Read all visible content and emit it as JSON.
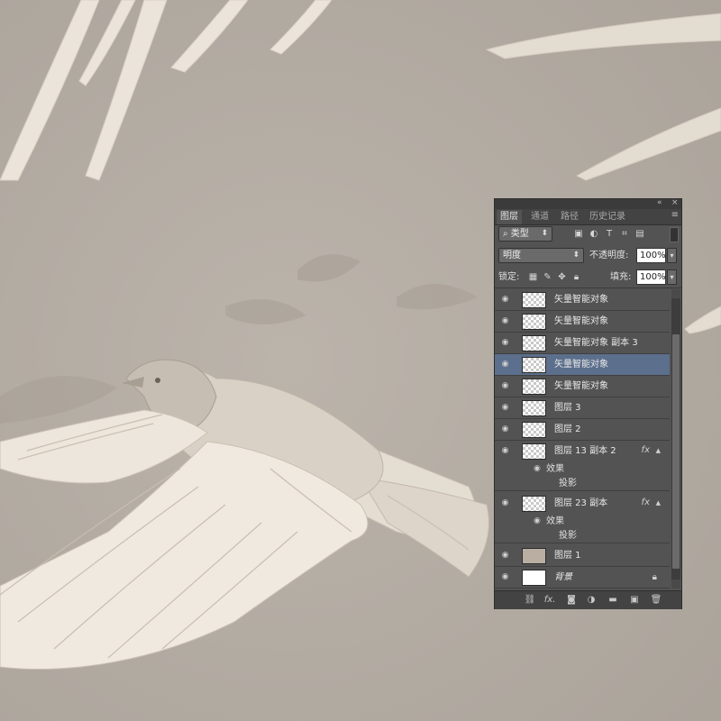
{
  "panel": {
    "collapse_icon": "double-left-arrow-icon",
    "close_icon": "close-icon",
    "tabs": [
      "图层",
      "通道",
      "路径",
      "历史记录"
    ],
    "tab_menu_icon": "panel-menu-icon",
    "filter": {
      "search_icon": "search-icon",
      "label": "类型",
      "icons": [
        "image-filter-icon",
        "adjustment-filter-icon",
        "text-filter-icon",
        "shape-filter-icon",
        "smart-object-filter-icon"
      ]
    },
    "blend_mode": "明度",
    "opacity_label": "不透明度:",
    "opacity_value": "100%",
    "lock_label": "锁定:",
    "lock_icons": [
      "lock-transparent-icon",
      "lock-image-icon",
      "lock-position-icon",
      "lock-all-icon"
    ],
    "fill_label": "填充:",
    "fill_value": "100%"
  },
  "layers": [
    {
      "name": "矢量智能对象"
    },
    {
      "name": "矢量智能对象"
    },
    {
      "name": "矢量智能对象 副本 3"
    },
    {
      "name": "矢量智能对象",
      "selected": true
    },
    {
      "name": "矢量智能对象"
    },
    {
      "name": "图层 3"
    },
    {
      "name": "图层 2"
    },
    {
      "name": "图层 13 副本 2",
      "fx": "fx",
      "effects_label": "效果",
      "effect": "投影"
    },
    {
      "name": "图层 23 副本",
      "fx": "fx",
      "effects_label": "效果",
      "effect": "投影"
    },
    {
      "name": "图层 1"
    },
    {
      "name": "背景"
    }
  ],
  "bottom_icons": [
    "link-layers-icon",
    "fx-icon",
    "layer-mask-icon",
    "adjustment-layer-icon",
    "new-group-icon",
    "new-layer-icon",
    "trash-icon"
  ],
  "colors": {
    "canvas_bg": "#b6afa7",
    "panel_bg": "#535353",
    "selected_row": "#5c6f8c"
  }
}
